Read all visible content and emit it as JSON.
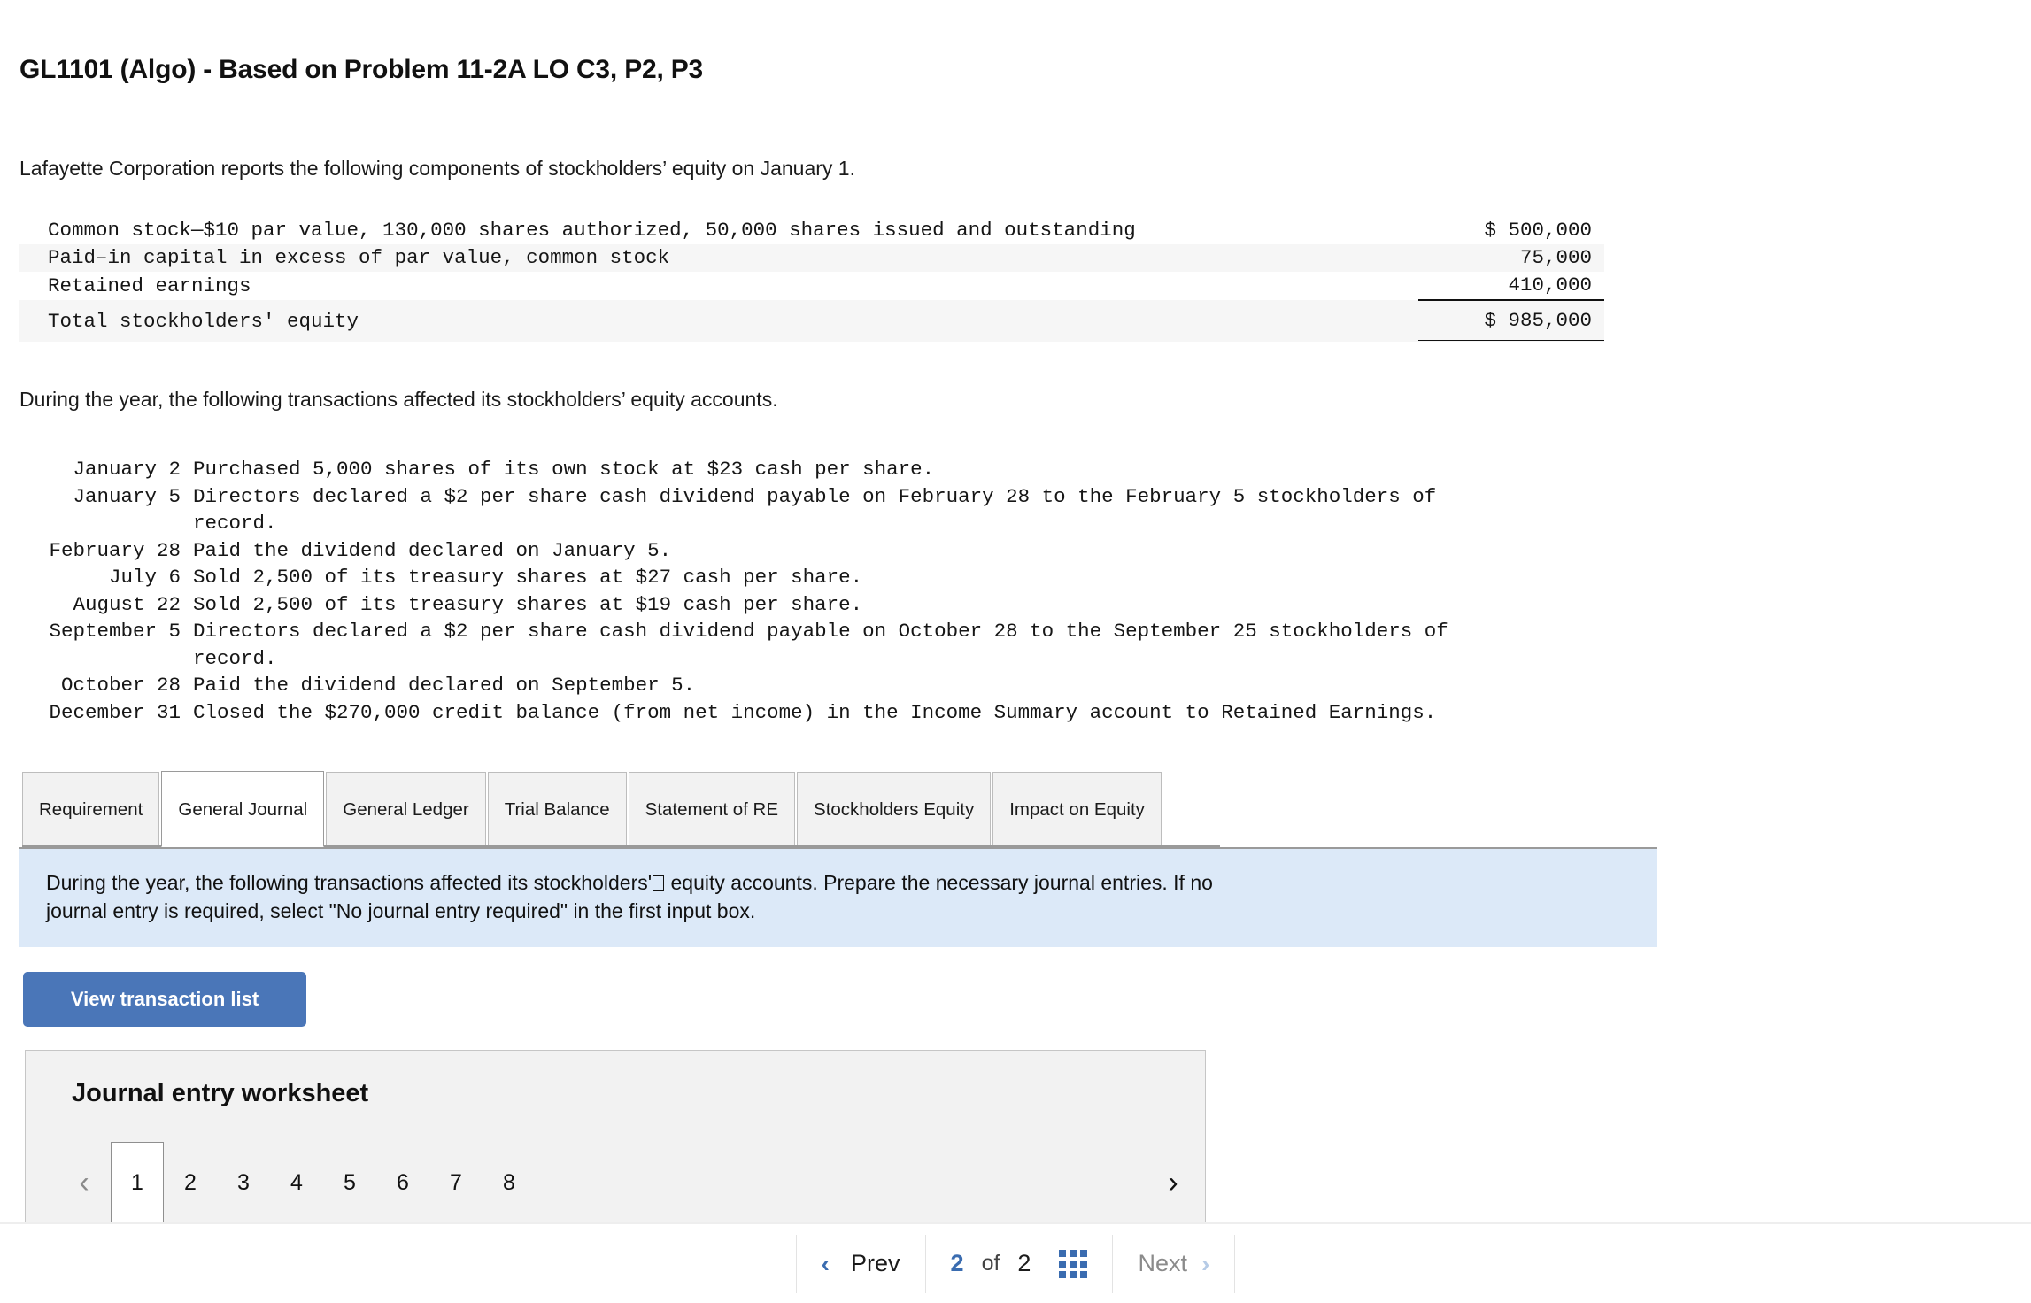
{
  "header": {
    "title": "GL1101 (Algo) - Based on Problem 11-2A LO C3, P2, P3"
  },
  "intro": {
    "text": "Lafayette Corporation reports the following components of stockholders’ equity on January 1."
  },
  "equity_table": {
    "rows": [
      {
        "label": "Common stock—$10 par value, 130,000 shares authorized, 50,000 shares issued and outstanding",
        "value": "$ 500,000"
      },
      {
        "label": "Paid–in capital in excess of par value, common stock",
        "value": "75,000"
      },
      {
        "label": "Retained earnings",
        "value": "410,000"
      },
      {
        "label": "Total stockholders' equity",
        "value": "$ 985,000"
      }
    ]
  },
  "during": {
    "text": "During the year, the following transactions affected its stockholders’ equity accounts."
  },
  "transactions": [
    {
      "date": "January 2",
      "desc": "Purchased 5,000 shares of its own stock at $23 cash per share."
    },
    {
      "date": "January 5",
      "desc": "Directors declared a $2 per share cash dividend payable on February 28 to the February 5 stockholders of\nrecord."
    },
    {
      "date": "February 28",
      "desc": "Paid the dividend declared on January 5."
    },
    {
      "date": "July 6",
      "desc": "Sold 2,500 of its treasury shares at $27 cash per share."
    },
    {
      "date": "August 22",
      "desc": "Sold 2,500 of its treasury shares at $19 cash per share."
    },
    {
      "date": "September 5",
      "desc": "Directors declared a $2 per share cash dividend payable on October 28 to the September 25 stockholders of\nrecord."
    },
    {
      "date": "October 28",
      "desc": "Paid the dividend declared on September 5."
    },
    {
      "date": "December 31",
      "desc": "Closed the $270,000 credit balance (from net income) in the Income Summary account to Retained Earnings."
    }
  ],
  "tabs": [
    {
      "label": "Requirement",
      "active": false
    },
    {
      "label": "General\nJournal",
      "active": true
    },
    {
      "label": "General\nLedger",
      "active": false
    },
    {
      "label": "Trial Balance",
      "active": false
    },
    {
      "label": "Statement of\nRE",
      "active": false
    },
    {
      "label": "Stockholders\nEquity",
      "active": false
    },
    {
      "label": "Impact on\nEquity",
      "active": false
    }
  ],
  "instruction": {
    "line1_before": "During the year, the following transactions affected its stockholders'",
    "line1_after": " equity accounts.  Prepare the necessary journal entries.  If no",
    "line2": "journal entry is required, select \"No journal entry required\" in the first input box."
  },
  "toolbar": {
    "view_transaction_list_label": "View transaction list"
  },
  "worksheet": {
    "title": "Journal entry worksheet",
    "prev_arrow": "‹",
    "next_arrow": "›",
    "pages": [
      "1",
      "2",
      "3",
      "4",
      "5",
      "6",
      "7",
      "8"
    ],
    "active_page": "1"
  },
  "bottom_nav": {
    "prev_label": "Prev",
    "prev_chevron": "‹",
    "current_page": "2",
    "of_label": "of",
    "total_pages": "2",
    "grid_icon": "grid-icon",
    "next_label": "Next",
    "next_chevron": "›"
  },
  "colors": {
    "accent_blue": "#4a76b8",
    "instruction_bg": "#dce9f8",
    "panel_bg": "#f2f2f2",
    "nav_blue": "#3a6cb0",
    "stripe": "#f6f6f6"
  }
}
